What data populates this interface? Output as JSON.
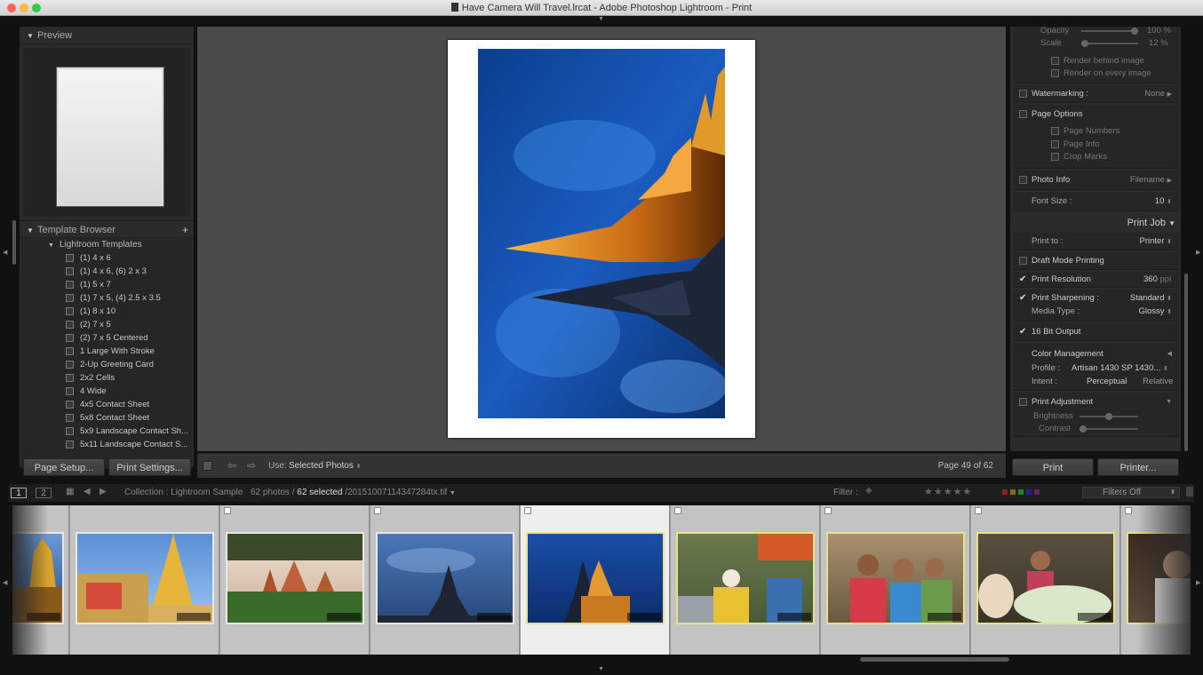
{
  "window": {
    "title": "Have Camera Will Travel.lrcat - Adobe Photoshop Lightroom - Print"
  },
  "left": {
    "preview_title": "Preview",
    "template_browser_title": "Template Browser",
    "add_symbol": "+",
    "folder": "Lightroom Templates",
    "templates": [
      "(1) 4 x 6",
      "(1) 4 x 6, (6) 2 x 3",
      "(1) 5 x 7",
      "(1) 7 x 5, (4) 2.5 x 3.5",
      "(1) 8 x 10",
      "(2) 7 x 5",
      "(2) 7 x 5 Centered",
      "1 Large With Stroke",
      "2-Up Greeting Card",
      "2x2 Cells",
      "4 Wide",
      "4x5 Contact Sheet",
      "5x8 Contact Sheet",
      "5x9 Landscape Contact Sh...",
      "5x11 Landscape Contact S..."
    ],
    "page_setup": "Page Setup...",
    "print_settings": "Print Settings..."
  },
  "toolbar": {
    "use_label": "Use:",
    "use_value": "Selected Photos",
    "page_info": "Page 49 of 62"
  },
  "right": {
    "opacity": "Opacity",
    "scale": "Scale",
    "opacity_val": "100 %",
    "scale_val": "12 %",
    "render_behind": "Render behind image",
    "render_every": "Render on every image",
    "watermarking": "Watermarking :",
    "watermarking_val": "None",
    "page_options": "Page Options",
    "page_numbers": "Page Numbers",
    "page_info": "Page Info",
    "crop_marks": "Crop Marks",
    "photo_info": "Photo Info",
    "photo_info_val": "Filename",
    "font_size": "Font Size :",
    "font_size_val": "10",
    "print_job": "Print Job",
    "print_to": "Print to :",
    "print_to_val": "Printer",
    "draft": "Draft Mode Printing",
    "print_resolution": "Print Resolution",
    "print_resolution_val": "360",
    "ppi": "ppi",
    "print_sharpening": "Print Sharpening :",
    "print_sharpening_val": "Standard",
    "media_type": "Media Type :",
    "media_type_val": "Glossy",
    "bit16": "16 Bit Output",
    "color_management": "Color Management",
    "profile": "Profile :",
    "profile_val": "Artisan 1430 SP 1430...",
    "intent": "Intent :",
    "intent_perceptual": "Perceptual",
    "intent_relative": "Relative",
    "print_adjustment": "Print Adjustment",
    "brightness": "Brightness",
    "contrast": "Contrast",
    "print_button": "Print",
    "printer_button": "Printer..."
  },
  "filmbar": {
    "view1": "1",
    "view2": "2",
    "source": "Collection : Lightroom Sample",
    "photos": "62 photos /",
    "selected": "62 selected",
    "filename": "/20151007114347284tx.tif",
    "filter_label": "Filter :",
    "filters_off": "Filters Off"
  },
  "accent": "#e6e28a"
}
